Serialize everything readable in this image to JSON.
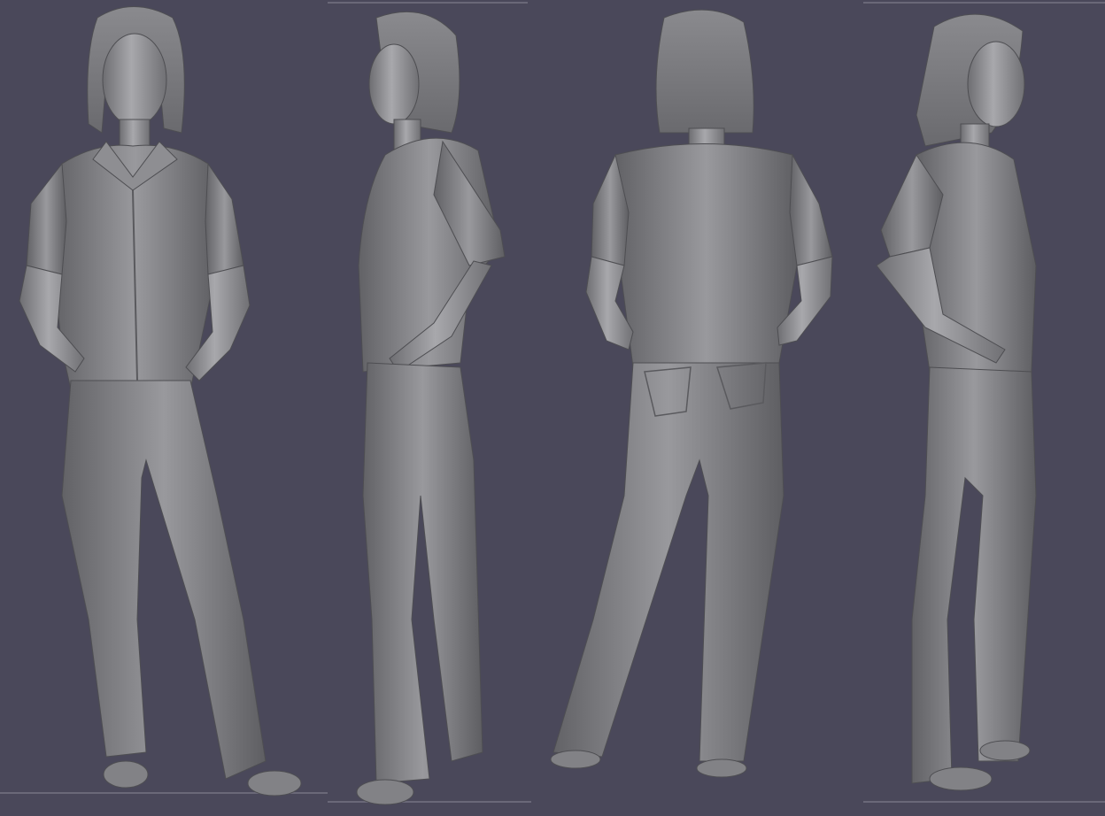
{
  "scene": {
    "background_color": "#4a485a",
    "model_color": "#8c8c8e",
    "model_shadow_color": "#5c5c60",
    "model_highlight_color": "#b4b4b8",
    "views": [
      {
        "orientation": "front"
      },
      {
        "orientation": "left-side"
      },
      {
        "orientation": "back"
      },
      {
        "orientation": "right-side"
      }
    ]
  }
}
